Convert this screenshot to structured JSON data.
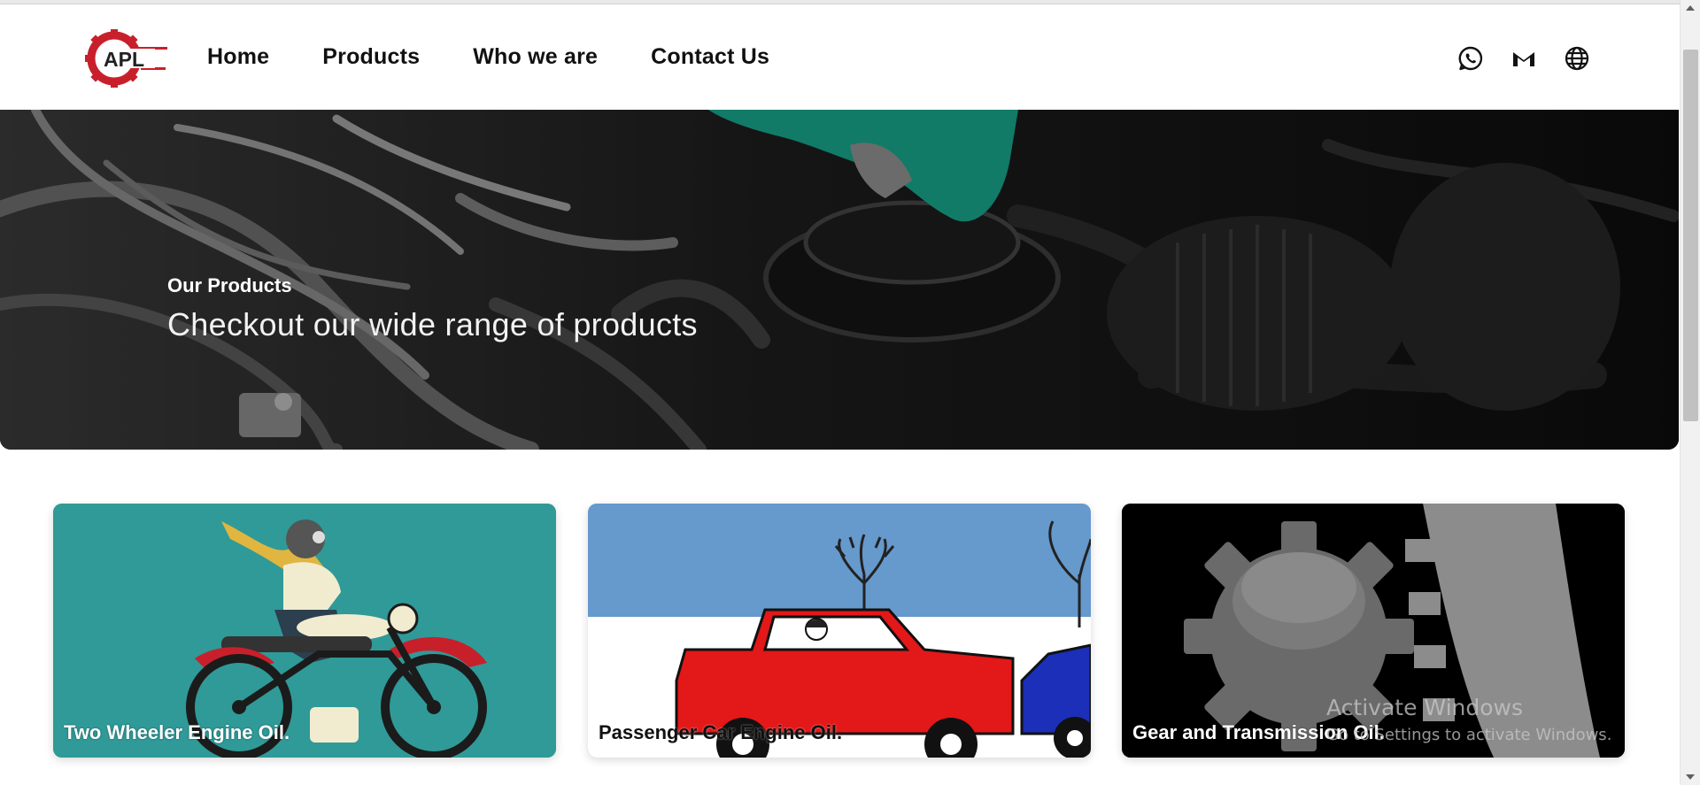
{
  "header": {
    "logo_text": "APL",
    "nav": [
      "Home",
      "Products",
      "Who we are",
      "Contact Us"
    ],
    "social_icons": [
      "whatsapp-icon",
      "gmail-icon",
      "globe-icon"
    ]
  },
  "hero": {
    "overline": "Our Products",
    "title": "Checkout our wide range of products"
  },
  "products": [
    {
      "label": "Two Wheeler Engine Oil."
    },
    {
      "label": "Passenger Car Engine Oil."
    },
    {
      "label": "Gear and Transmission Oil."
    }
  ],
  "watermark": {
    "title": "Activate Windows",
    "subtitle": "Go to Settings to activate Windows."
  },
  "colors": {
    "brand_red": "#c8202b",
    "brand_dark": "#222222",
    "card_teal": "#2f9a98",
    "sky_blue": "#6699cc"
  }
}
